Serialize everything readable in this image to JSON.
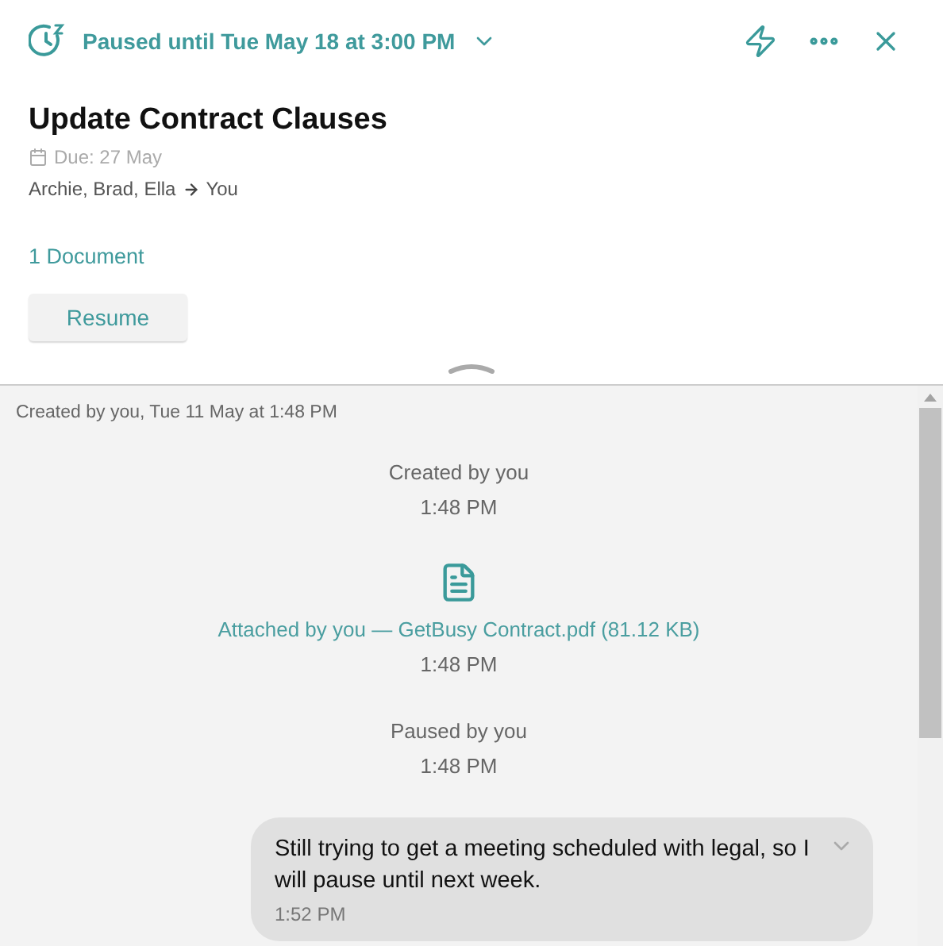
{
  "header": {
    "status": "Paused until Tue May 18 at 3:00 PM"
  },
  "task": {
    "title": "Update Contract Clauses",
    "due": "Due: 27 May",
    "assigners": "Archie, Brad, Ella",
    "assignee": "You",
    "documents": "1 Document",
    "action": "Resume"
  },
  "activity": {
    "created_note": "Created by you, Tue 11 May at 1:48 PM",
    "items": [
      {
        "kind": "event",
        "text": "Created by you",
        "time": "1:48 PM"
      },
      {
        "kind": "attachment",
        "text": "Attached by you — GetBusy Contract.pdf (81.12 KB)",
        "time": "1:48 PM"
      },
      {
        "kind": "event",
        "text": "Paused by you",
        "time": "1:48 PM"
      },
      {
        "kind": "message",
        "text": "Still trying to get a meeting scheduled with legal, so I will pause until next week.",
        "time": "1:52 PM"
      }
    ]
  }
}
